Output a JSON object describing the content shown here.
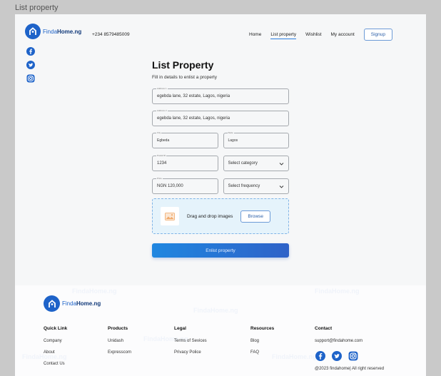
{
  "frame": {
    "title": "List property"
  },
  "header": {
    "logo": {
      "part1": "Finda",
      "part2": "Home.ng"
    },
    "phone": "+234 8579485009",
    "nav": [
      {
        "label": "Home",
        "active": false
      },
      {
        "label": "List property",
        "active": true
      },
      {
        "label": "Wishlist",
        "active": false
      },
      {
        "label": "My account",
        "active": false
      }
    ],
    "signup_label": "Signup"
  },
  "social": [
    "facebook-icon",
    "twitter-icon",
    "instagram-icon"
  ],
  "form": {
    "title": "List Property",
    "subtitle": "Fill in details to enlist a property",
    "fields": {
      "address1": {
        "label": "Address 1",
        "value": "egebda lane, 32 estate, Lagos, nigeria"
      },
      "address2": {
        "label": "Address 2",
        "value": "egebda lane, 32 estate, Lagos, nigeria"
      },
      "city": {
        "label": "City",
        "value": "Egbeda"
      },
      "state": {
        "label": "State",
        "value": "Lagos"
      },
      "postal": {
        "label": "Postal ID",
        "value": "1234"
      },
      "category": {
        "value": "Select category"
      },
      "price": {
        "label": "Price",
        "value": "NGN 120,000"
      },
      "frequency": {
        "value": "Select frequency"
      }
    },
    "dropzone": {
      "text": "Drag and drop images",
      "browse_label": "Browse"
    },
    "submit_label": "Enlist property"
  },
  "footer": {
    "logo": {
      "part1": "Finda",
      "part2": "Home.ng"
    },
    "watermark": "FindaHome.ng",
    "columns": [
      {
        "heading": "Quick Link",
        "links": [
          "Company",
          "About",
          "Contact Us"
        ]
      },
      {
        "heading": "Products",
        "links": [
          "Unidash",
          "Expresscom"
        ]
      },
      {
        "heading": "Legal",
        "links": [
          "Terms of Sevices",
          "Privacy Police"
        ]
      },
      {
        "heading": "Resources",
        "links": [
          "Blog",
          "FAQ"
        ]
      }
    ],
    "contact": {
      "heading": "Contact",
      "email": "support@findahome.com",
      "copyright": "@2023 findahome| All right reserved"
    }
  },
  "colors": {
    "brand": "#1e63c9",
    "button_start": "#1f86e0",
    "button_end": "#2f62c8",
    "dropzone_bg": "#e5f3fb"
  }
}
